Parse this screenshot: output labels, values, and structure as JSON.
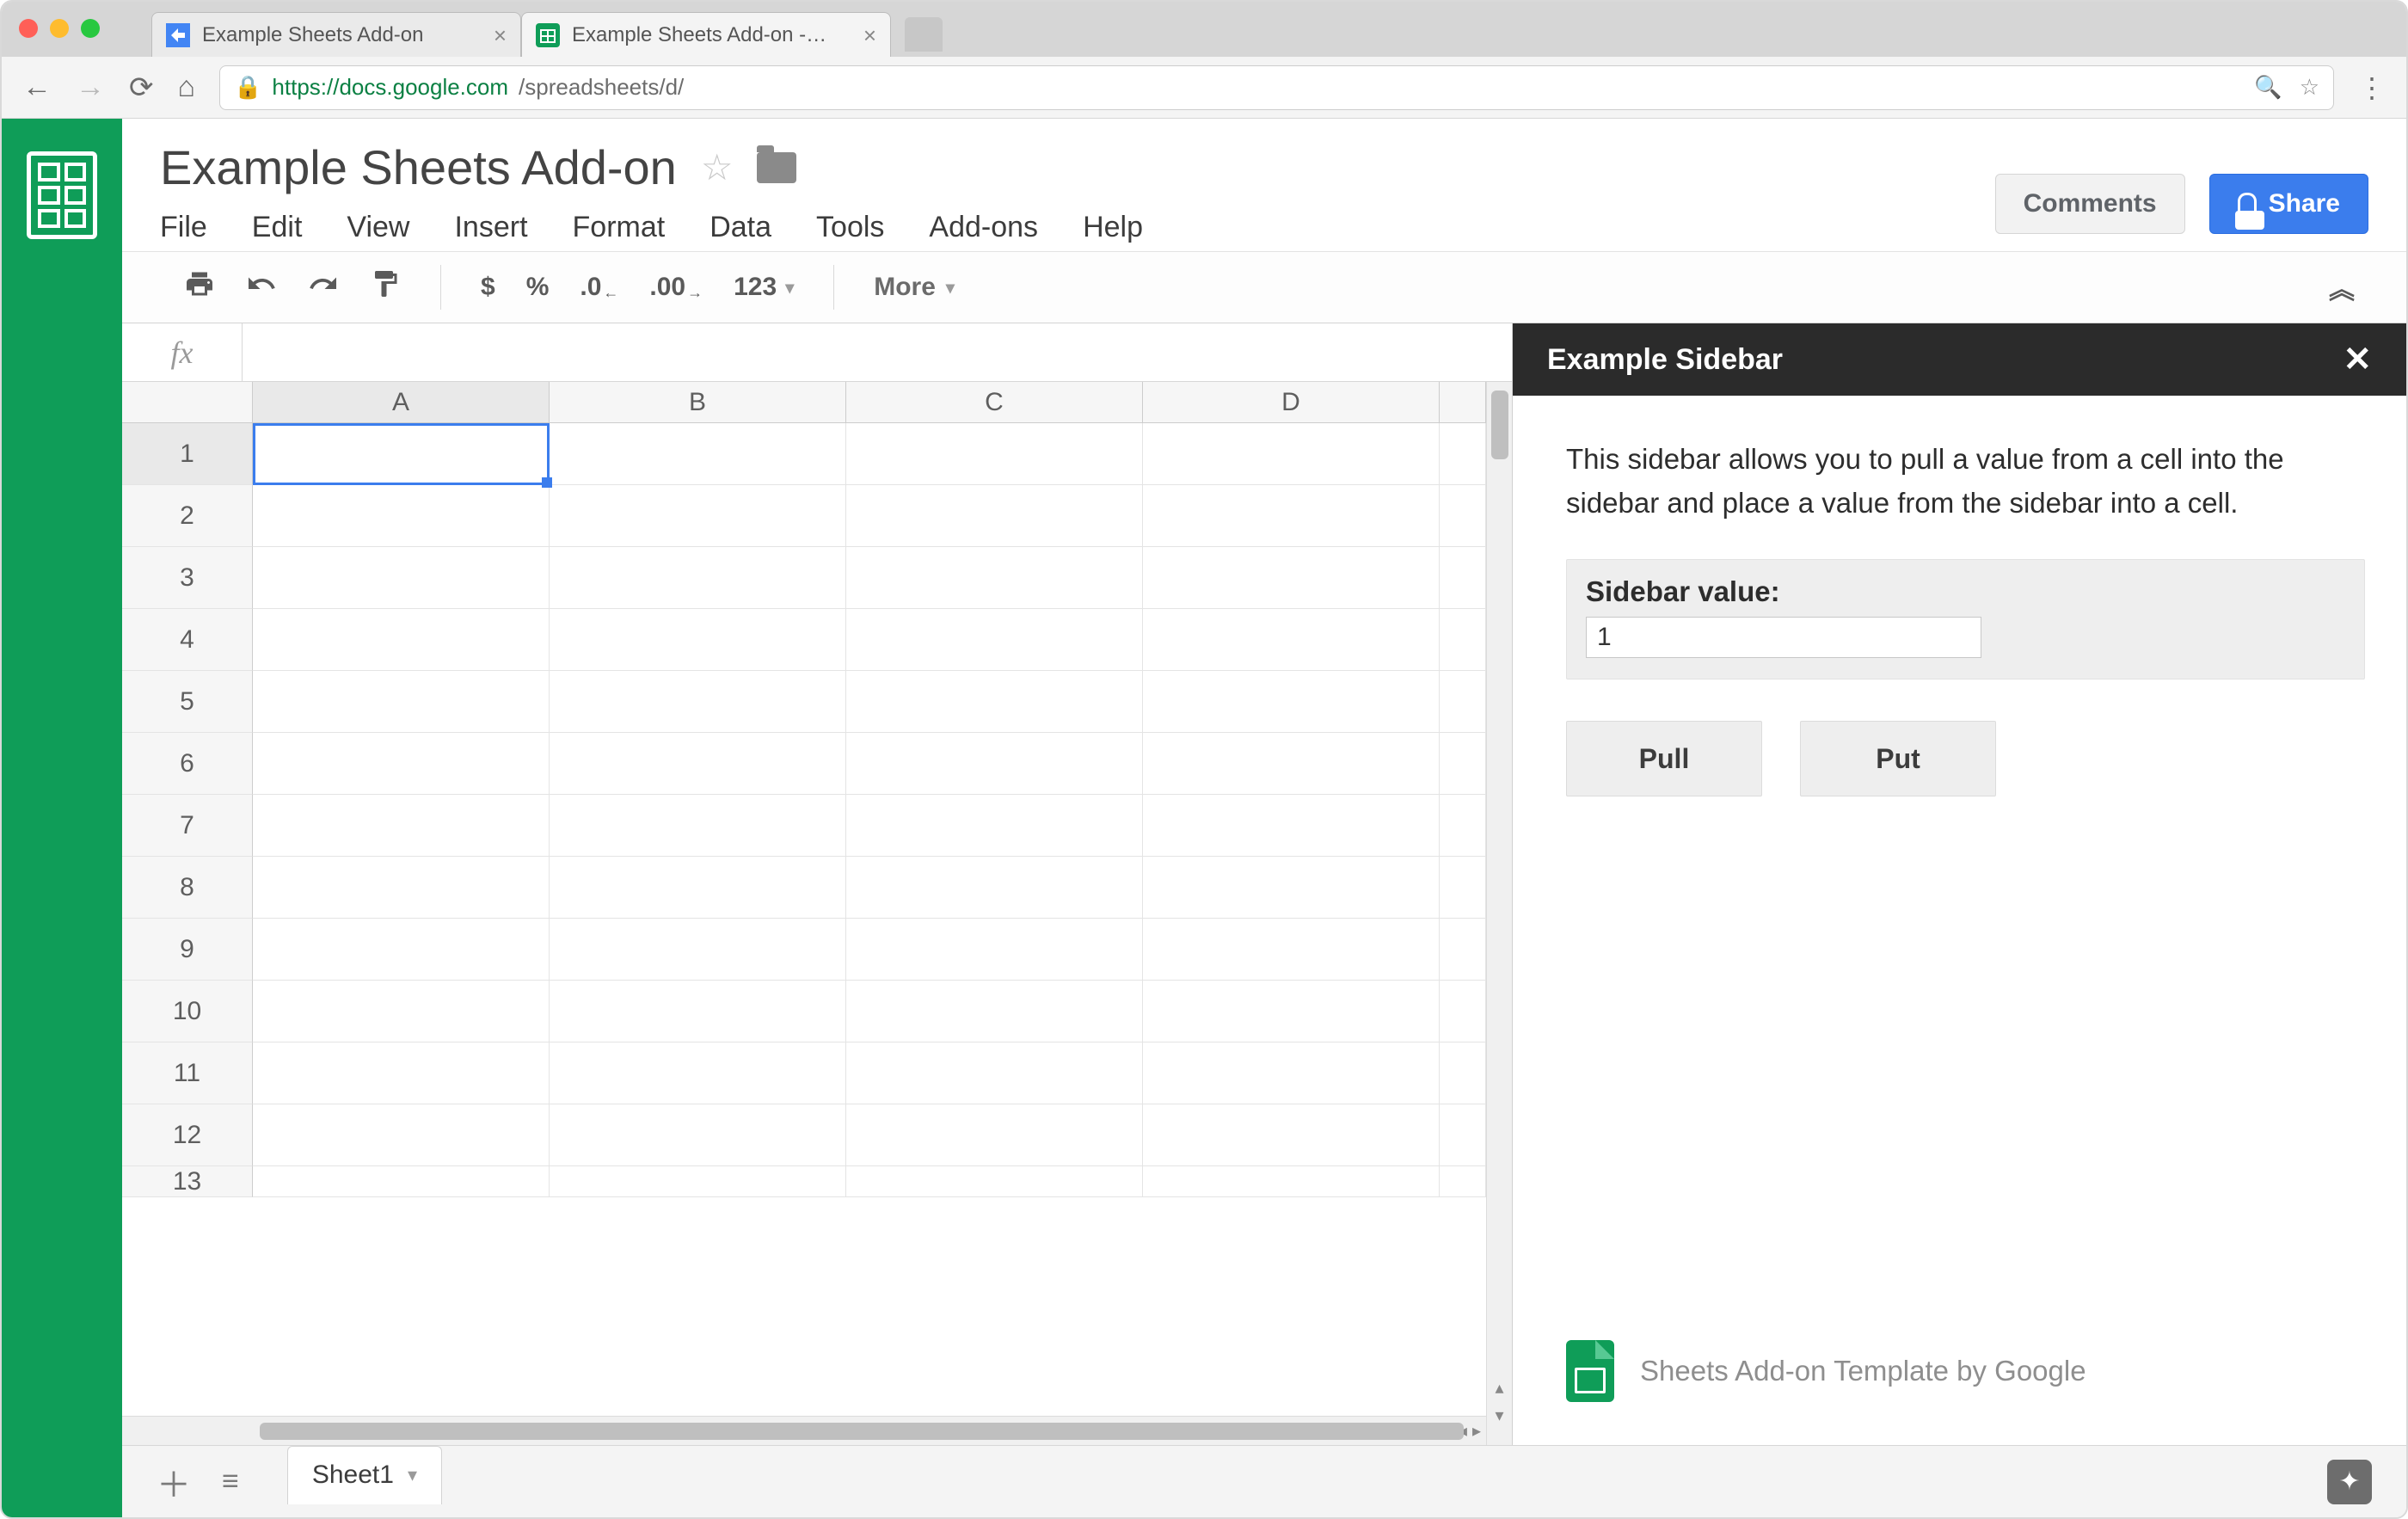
{
  "browser": {
    "tabs": [
      {
        "title": "Example Sheets Add-on",
        "active": false
      },
      {
        "title": "Example Sheets Add-on - Goo…",
        "active": true
      }
    ],
    "url_host": "https://docs.google.com",
    "url_path": "/spreadsheets/d/"
  },
  "doc": {
    "title": "Example Sheets Add-on",
    "menus": [
      "File",
      "Edit",
      "View",
      "Insert",
      "Format",
      "Data",
      "Tools",
      "Add-ons",
      "Help"
    ],
    "comments_btn": "Comments",
    "share_btn": "Share"
  },
  "toolbar": {
    "t_currency": "$",
    "t_percent": "%",
    "t_decdec": ".0",
    "t_decinc": ".00",
    "t_numfmt": "123",
    "t_more": "More"
  },
  "formula_bar": {
    "label": "fx",
    "value": ""
  },
  "grid": {
    "columns": [
      "A",
      "B",
      "C",
      "D"
    ],
    "rows": [
      "1",
      "2",
      "3",
      "4",
      "5",
      "6",
      "7",
      "8",
      "9",
      "10",
      "11",
      "12",
      "13"
    ],
    "active_cell": "A1"
  },
  "sidebar": {
    "title": "Example Sidebar",
    "description": "This sidebar allows you to pull a value from a cell into the sidebar and place a value from the sidebar into a cell.",
    "value_label": "Sidebar value:",
    "value": "1",
    "pull_btn": "Pull",
    "put_btn": "Put",
    "footer": "Sheets Add-on Template by Google"
  },
  "tabs": {
    "sheet1": "Sheet1"
  }
}
